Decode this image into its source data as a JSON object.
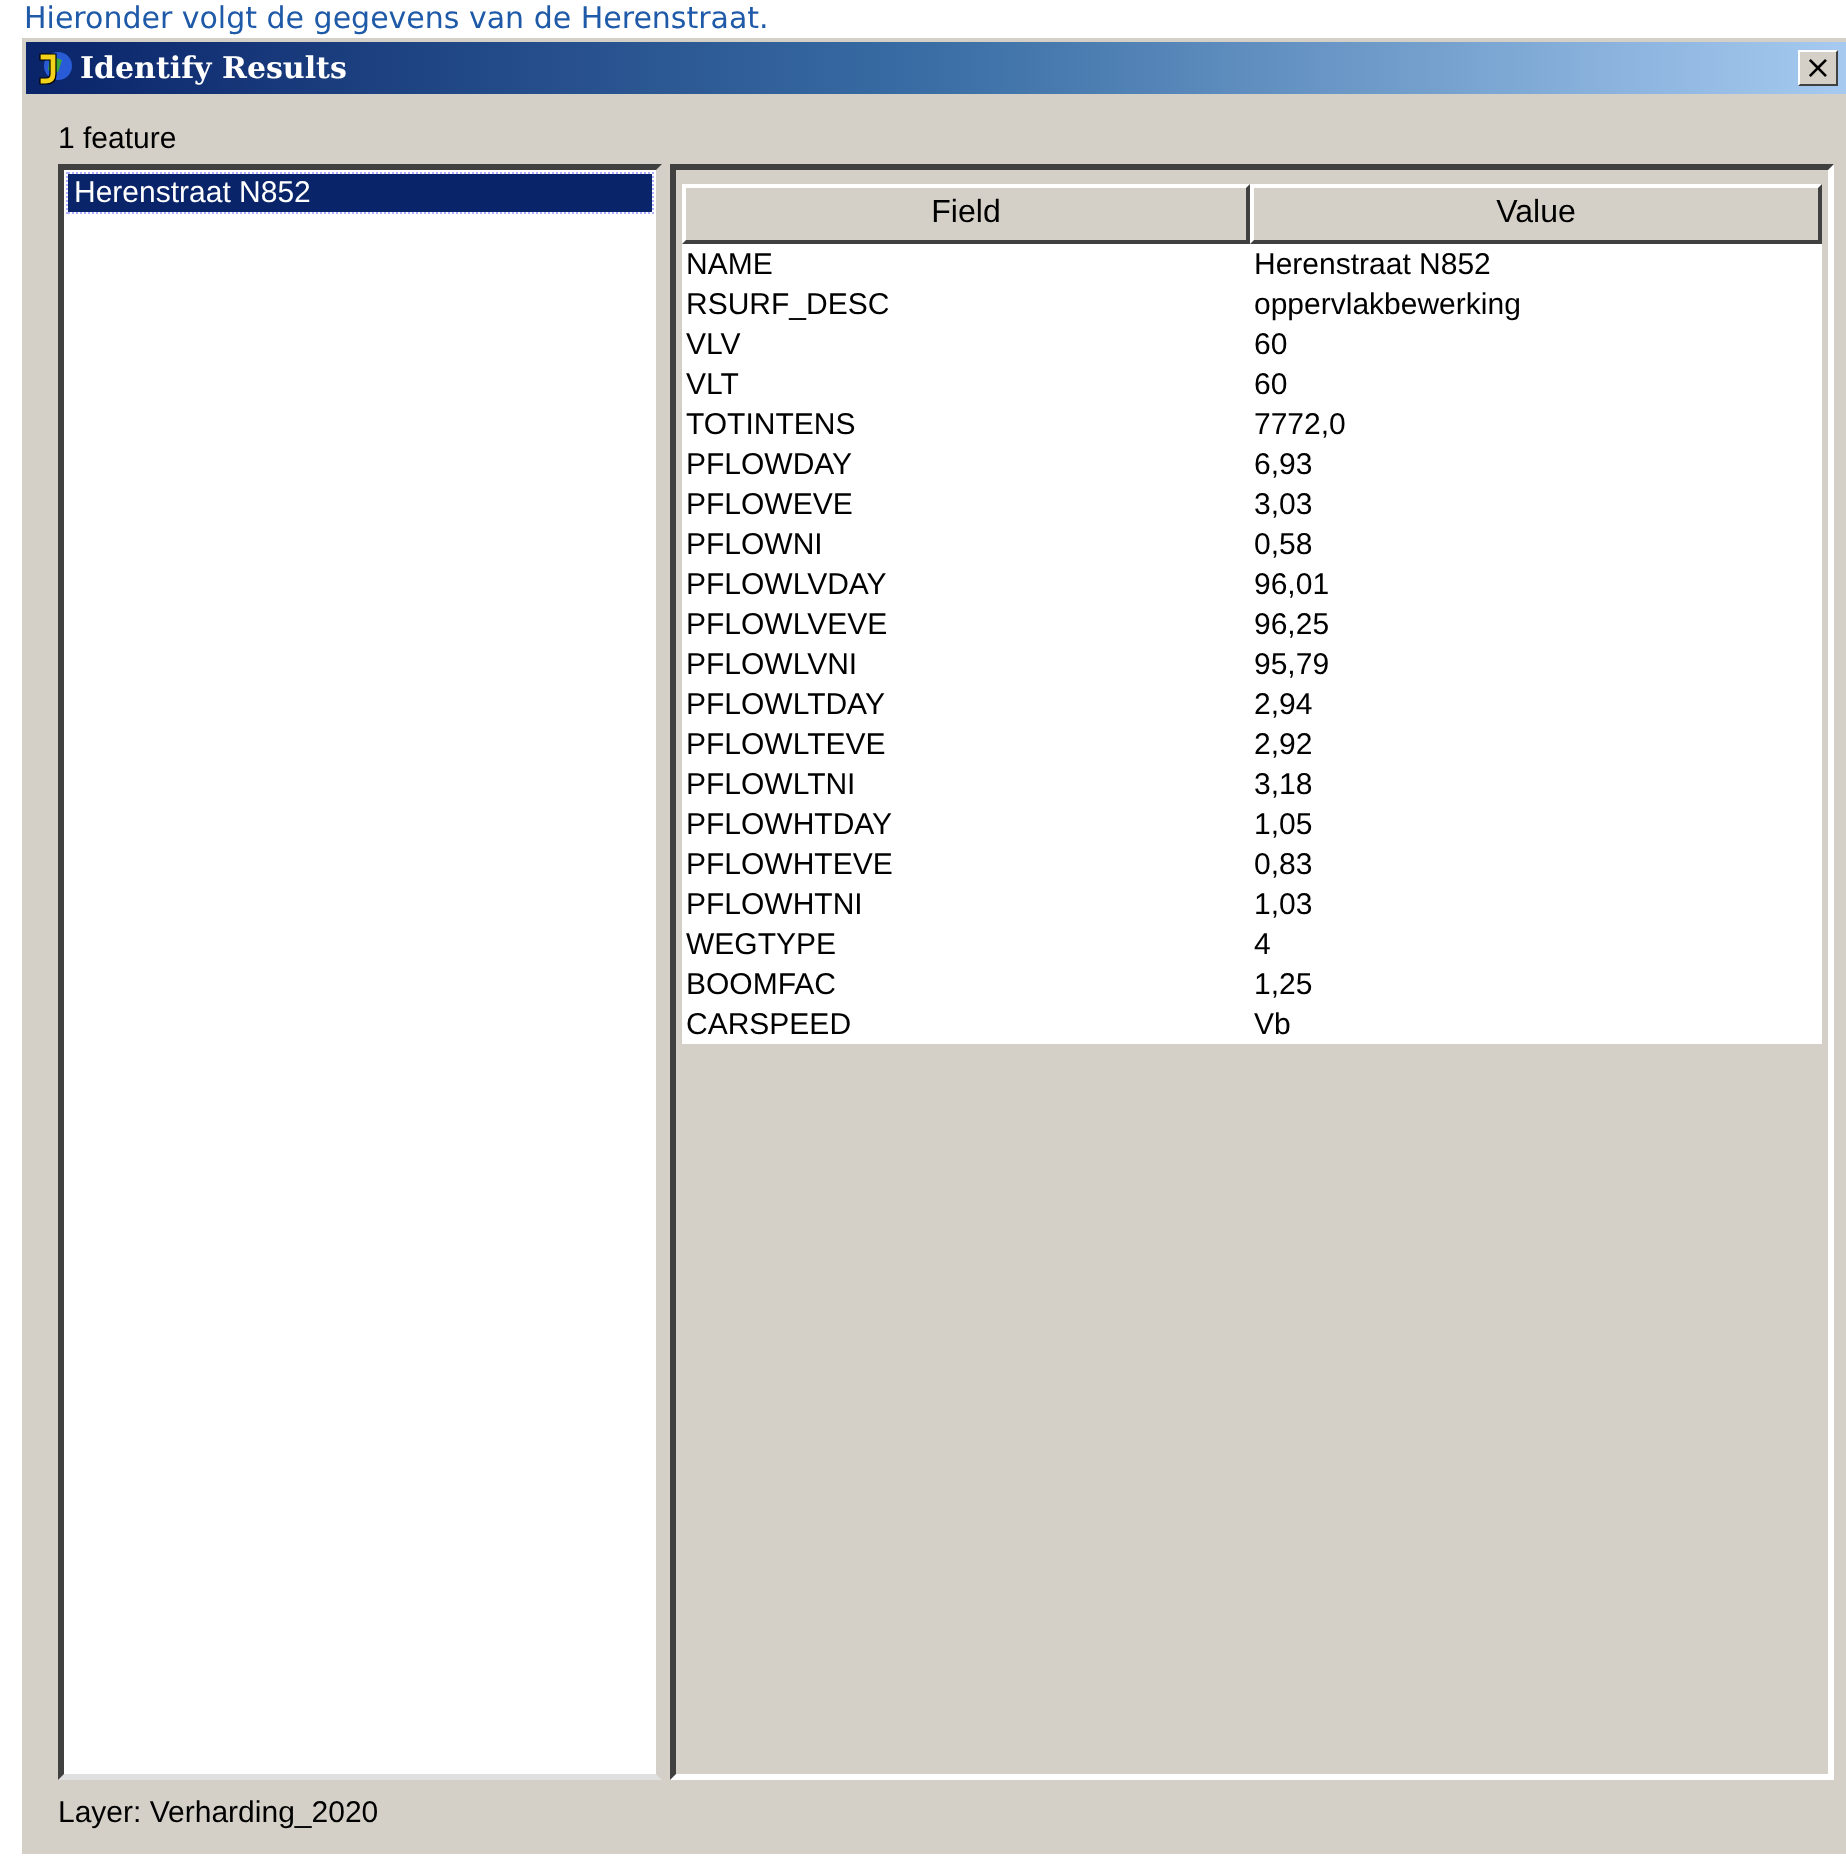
{
  "caption": "Hieronder volgt de gegevens van de Herenstraat.",
  "window": {
    "title": "Identify Results",
    "close": "×"
  },
  "feature_count": "1 feature",
  "features": [
    {
      "label": "Herenstraat N852",
      "selected": true
    }
  ],
  "table": {
    "columns": [
      "Field",
      "Value"
    ],
    "rows": [
      [
        "NAME",
        "Herenstraat N852"
      ],
      [
        "RSURF_DESC",
        "oppervlakbewerking"
      ],
      [
        "VLV",
        "60"
      ],
      [
        "VLT",
        "60"
      ],
      [
        "TOTINTENS",
        "7772,0"
      ],
      [
        "PFLOWDAY",
        "6,93"
      ],
      [
        "PFLOWEVE",
        "3,03"
      ],
      [
        "PFLOWNI",
        "0,58"
      ],
      [
        "PFLOWLVDAY",
        "96,01"
      ],
      [
        "PFLOWLVEVE",
        "96,25"
      ],
      [
        "PFLOWLVNI",
        "95,79"
      ],
      [
        "PFLOWLTDAY",
        "2,94"
      ],
      [
        "PFLOWLTEVE",
        "2,92"
      ],
      [
        "PFLOWLTNI",
        "3,18"
      ],
      [
        "PFLOWHTDAY",
        "1,05"
      ],
      [
        "PFLOWHTEVE",
        "0,83"
      ],
      [
        "PFLOWHTNI",
        "1,03"
      ],
      [
        "WEGTYPE",
        "4"
      ],
      [
        "BOOMFAC",
        "1,25"
      ],
      [
        "CARSPEED",
        "Vb"
      ]
    ]
  },
  "status": "Layer: Verharding_2020"
}
